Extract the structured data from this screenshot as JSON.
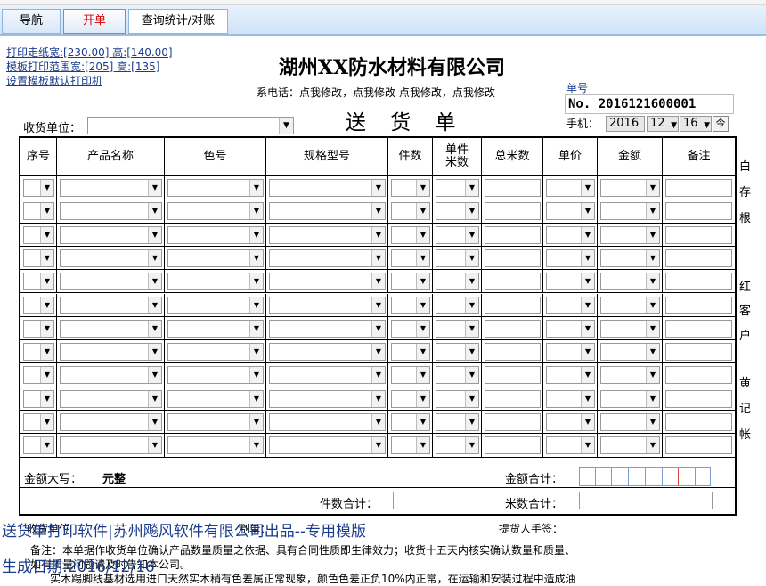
{
  "tabs": [
    {
      "label": "导航"
    },
    {
      "label": "开单"
    },
    {
      "label": "查询统计/对账"
    }
  ],
  "print_links": [
    "打印走纸宽:[230.00] 高:[140.00]",
    "模板打印范围宽:[205] 高:[135]",
    "设置模板默认打印机"
  ],
  "company_name": "湖州XX防水材料有限公司",
  "contact_text": "系电话：点我修改，点我修改 点我修改，点我修改",
  "doc_title": "送 货 单",
  "order_no_label": "单号",
  "order_no_value": "No. 2016121600001",
  "phone_label": "手机：",
  "date": {
    "year": "2016",
    "month": "12",
    "day": "16"
  },
  "receiver_label": "收货单位：",
  "receiver_value": "",
  "columns": [
    "序号",
    "产品名称",
    "色号",
    "规格型号",
    "件数",
    "单件\n米数",
    "总米数",
    "单价",
    "金额",
    "备注"
  ],
  "row_count": 12,
  "side_labels": [
    "白",
    "存",
    "根",
    "红",
    "客",
    "户",
    "黄",
    "记",
    "帐"
  ],
  "amount_upper_label": "金额大写：",
  "amount_upper_value": "元整",
  "amount_total_label": "金额合计：",
  "count_total_label": "件数合计：",
  "meter_total_label": "米数合计：",
  "footer": {
    "watermark1": "送货单打印软件|苏州飚风软件有限公司出品--专用模版",
    "watermark2": "生成日期:2016/12/16",
    "receiver_sign": "收货单位",
    "maker": "制单：",
    "picker": "提货人手签：",
    "note1": "备注：本单据作收货单位确认产品数量质量之依据、具有合同性质即生律效力；收货十五天内核实确认数量和质量、",
    "note2": "如有质量问题请及时告知本公司。",
    "note3": "实木踢脚线基材选用进口天然实木稍有色差属正常现象，颜色色差正负10%内正常，在运输和安装过程中造成油"
  }
}
